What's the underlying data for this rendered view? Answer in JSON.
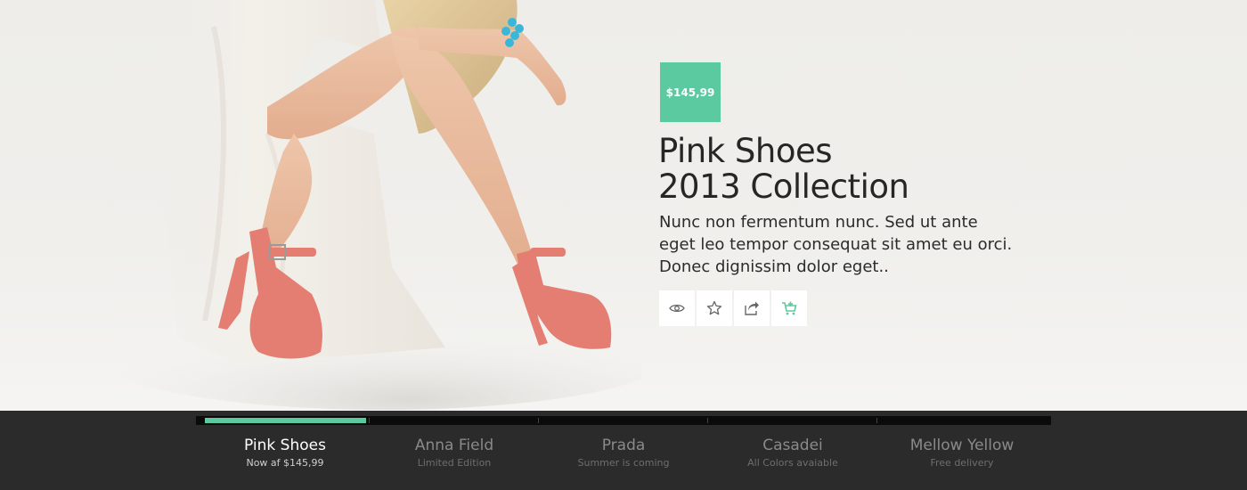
{
  "hero": {
    "image_alt": "Model in white dress wearing pink high-heel sandals",
    "price": "$145,99",
    "title_lines": [
      "Pink Shoes",
      "2013 Collection"
    ],
    "description_lines": [
      "Nunc non fermentum nunc. Sed ut ante",
      "eget leo tempor consequat sit amet eu orci.",
      "Donec dignissim dolor eget.."
    ],
    "actions": [
      {
        "icon": "eye-icon"
      },
      {
        "icon": "star-icon"
      },
      {
        "icon": "share-icon"
      },
      {
        "icon": "cart-add-icon"
      }
    ]
  },
  "slider": {
    "active_index": 0,
    "progress_fraction": 0.95,
    "items": [
      {
        "title": "Pink Shoes",
        "subtitle": "Now af $145,99"
      },
      {
        "title": "Anna Field",
        "subtitle": "Limited Edition"
      },
      {
        "title": "Prada",
        "subtitle": "Summer is coming"
      },
      {
        "title": "Casadei",
        "subtitle": "All Colors avaiable"
      },
      {
        "title": "Mellow Yellow",
        "subtitle": "Free delivery"
      }
    ]
  },
  "colors": {
    "accent": "#5ccaa0",
    "bottom_bar": "#2b2b2b",
    "progress_track": "#0b0b0b"
  }
}
